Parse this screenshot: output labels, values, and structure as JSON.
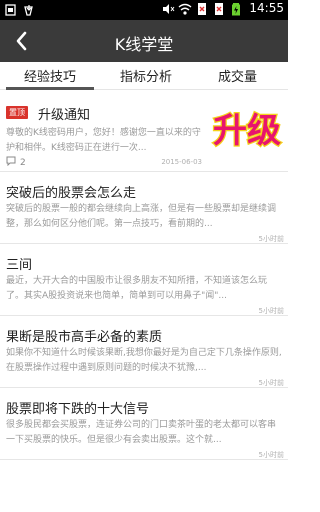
{
  "status_bar": {
    "time": "14:55",
    "icons": [
      "notification-icon",
      "download-icon",
      "mute-icon",
      "wifi-icon",
      "sim-off-icon",
      "signal-off-icon",
      "battery-charging-icon"
    ]
  },
  "header": {
    "title": "K线学堂",
    "back_icon": "back-arrow-icon"
  },
  "tabs": [
    {
      "label": "经验技巧",
      "active": true
    },
    {
      "label": "指标分析",
      "active": false
    },
    {
      "label": "成交量",
      "active": false
    }
  ],
  "featured": {
    "badge": "置顶",
    "title": "升级通知",
    "desc": "尊敬的K线密码用户，您好！感谢您一直以来的守护和相伴。K线密码正在进行一次...",
    "comment_count": "2",
    "date": "2015-06-03",
    "thumb_text": "升级"
  },
  "articles": [
    {
      "title": "突破后的股票会怎么走",
      "desc": "突破后的股票一般的都会继续向上高涨，但是有一些股票却是继续调整，那么如何区分他们呢。第一点技巧，看前期的...",
      "time": "5小时前"
    },
    {
      "title": "三间",
      "desc": "最近，大开大合的中国股市让很多朋友不知所措，不知道该怎么玩了。其实A股投资说来也简单，简单到可以用鼻子\"闻\"...",
      "time": "5小时前"
    },
    {
      "title": "果断是股市高手必备的素质",
      "desc": "如果你不知道什么时候该果断,我想你最好是为自己定下几条操作原则,在股票操作过程中遇到原则问题的时候决不犹豫,...",
      "time": "5小时前"
    },
    {
      "title": "股票即将下跌的十大信号",
      "desc": "很多股民都会买股票，连证券公司的门口卖茶叶蛋的老太都可以客串一下买股票的快乐。但是很少有会卖出股票。这个就...",
      "time": "5小时前"
    }
  ],
  "colors": {
    "appbar": "#3a3a3a",
    "badge": "#d9332c",
    "thumb_text": "#e8146e",
    "thumb_outline": "#f4d21a"
  }
}
